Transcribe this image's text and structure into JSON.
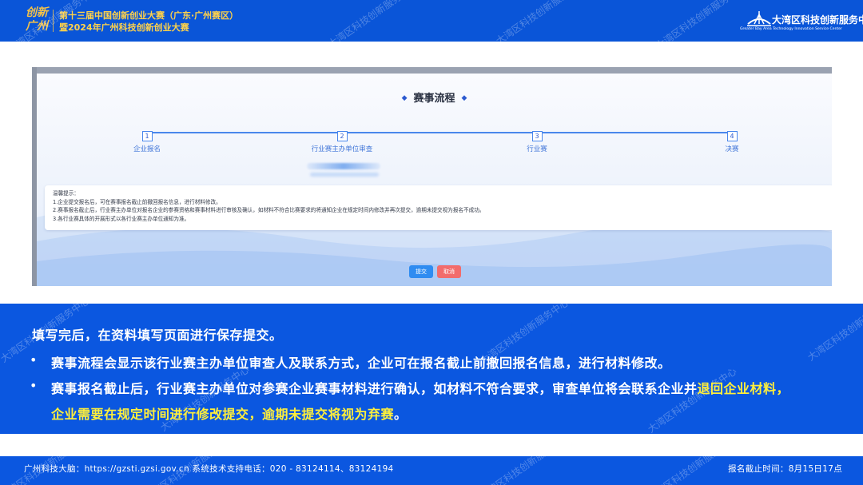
{
  "header": {
    "logo_text_1": "创新",
    "logo_text_2": "广州",
    "title_line1": "第十三届中国创新创业大赛（广东·广州赛区）",
    "title_line2": "暨2024年广州科技创新创业大赛",
    "brand_name": "大湾区科技创新服务中心",
    "brand_en": "Greater Bay Area Technology Innovation Service Center"
  },
  "watermark": "大湾区科技创新服务中心",
  "modal": {
    "title": "赛事流程",
    "steps": [
      {
        "num": "1",
        "label": "企业报名"
      },
      {
        "num": "2",
        "label": "行业赛主办单位审查"
      },
      {
        "num": "3",
        "label": "行业赛"
      },
      {
        "num": "4",
        "label": "决赛"
      }
    ],
    "tips": [
      "温馨提示：",
      "1.企业提交报名后，可在赛事报名截止前撤回报名信息，进行材料修改。",
      "2.赛事报名截止后，行业赛主办单位对报名企业的参赛资格和赛事材料进行审核及确认，如材料不符合比赛要求的将通知企业在规定时间内修改并再次提交，逾期未提交视为报名不成功。",
      "3.各行业赛具体的开展形式以各行业赛主办单位通知为准。"
    ],
    "submit_label": "提交",
    "cancel_label": "取消"
  },
  "info": {
    "intro": "填写完后，在资料填写页面进行保存提交。",
    "bullet_symbol": "•",
    "line1": "赛事流程会显示该行业赛主办单位审查人及联系方式，企业可在报名截止前撤回报名信息，进行材料修改。",
    "line2_a": "赛事报名截止后，行业赛主办单位对参赛企业赛事材料进行确认，如材料不符合要求，审查单位将会联系企业并",
    "line2_hl": "退回企业材料，",
    "line3_hl": "企业需要在规定时间进行修改提交，逾期未提交将视为弃赛",
    "line3_end": "。"
  },
  "footer": {
    "left": "广州科技大脑：https://gzsti.gzsi.gov.cn   系统技术支持电话：020 - 83124114、83124194",
    "right": "报名截止时间：8月15日17点"
  },
  "colors": {
    "primary_blue": "#0b57e0",
    "highlight_yellow": "#ffef3b",
    "submit_blue": "#2f8cf1",
    "cancel_red": "#f26c6c"
  }
}
